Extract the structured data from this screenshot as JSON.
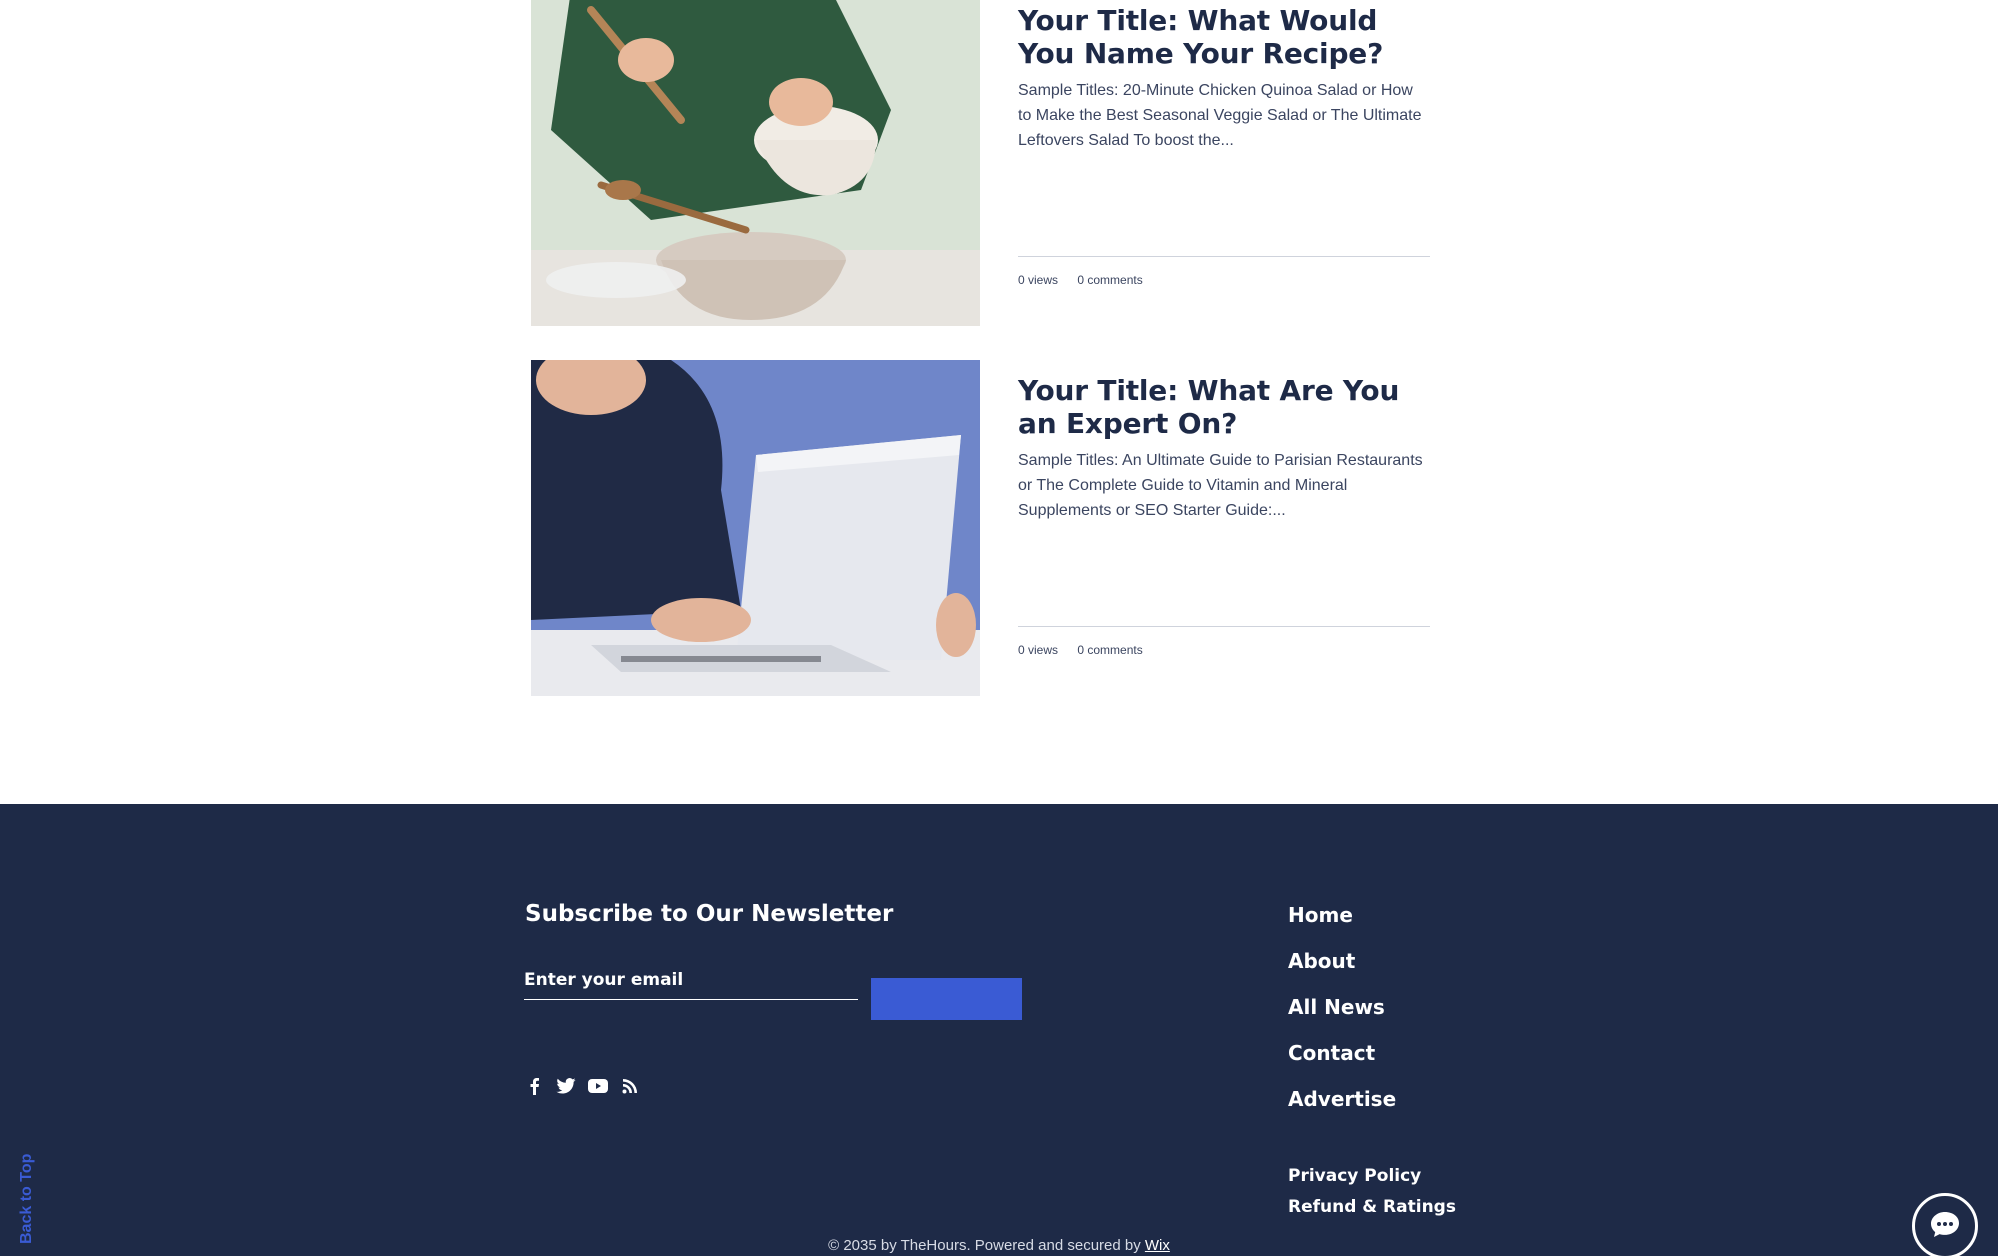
{
  "posts": [
    {
      "title": "Your Title: What Would You Name Your Recipe?",
      "excerpt": "Sample Titles: 20-Minute Chicken Quinoa Salad or How to Make the Best Seasonal Veggie Salad or The Ultimate Leftovers Salad To boost the...",
      "views": "0 views",
      "comments": "0 comments"
    },
    {
      "title": "Your Title: What Are You an Expert On?",
      "excerpt": "Sample Titles: An Ultimate Guide to Parisian Restaurants or The Complete Guide to Vitamin and Mineral Supplements or SEO Starter Guide:...",
      "views": "0 views",
      "comments": "0 comments"
    }
  ],
  "footer": {
    "newsletter_title": "Subscribe to Our Newsletter",
    "email_placeholder": "Enter your email",
    "social_icons": [
      "facebook-icon",
      "twitter-icon",
      "youtube-icon",
      "rss-icon"
    ],
    "nav": [
      "Home",
      "About",
      "All News",
      "Contact",
      "Advertise"
    ],
    "legal": [
      "Privacy Policy",
      "Refund & Ratings"
    ],
    "back_to_top": "Back to Top",
    "copyright_prefix": "© 2035 by TheHours. Powered and secured by ",
    "copyright_link": "Wix"
  },
  "colors": {
    "navy": "#1e2a47",
    "accent_blue": "#3a5bd4",
    "white": "#ffffff"
  },
  "chat_icon": "chat-icon"
}
